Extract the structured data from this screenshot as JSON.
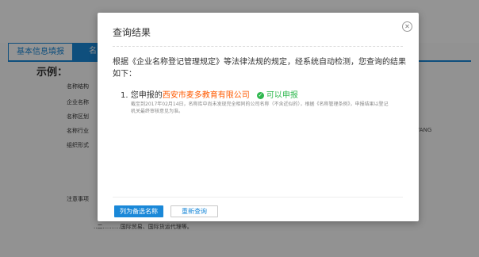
{
  "background": {
    "tabs": [
      "基本信息填报",
      "名"
    ],
    "example_title": "示例：",
    "field_labels": [
      "名称结构",
      "企业名称",
      "名称区划",
      "名称行业",
      "组织形式"
    ],
    "notes_label": "注意事项",
    "notes_text": "..二..........国际贸易、国际货运代理等。",
    "side_text": "GYANG"
  },
  "dialog": {
    "title": "查询结果",
    "close_icon": "close-icon",
    "description": "根据《企业名称登记管理规定》等法律法规的规定，经系统自动检测，您查询的结果如下：",
    "result": {
      "prefix": "1. 您申报的",
      "company": "西安市麦多教育有限公司",
      "status": "可以申报",
      "detail": "截至到2017年02月14日，名称库中尚未发现完全相同的公司名称（不含近似的），根据《名称管理条例》，申报结果以登记机关最终审核意见为准。"
    },
    "buttons": {
      "primary": "列为备选名称",
      "secondary": "重新查询"
    }
  },
  "colors": {
    "accent": "#1a88d8",
    "company": "#ff5a00",
    "ok": "#2fb84f"
  }
}
